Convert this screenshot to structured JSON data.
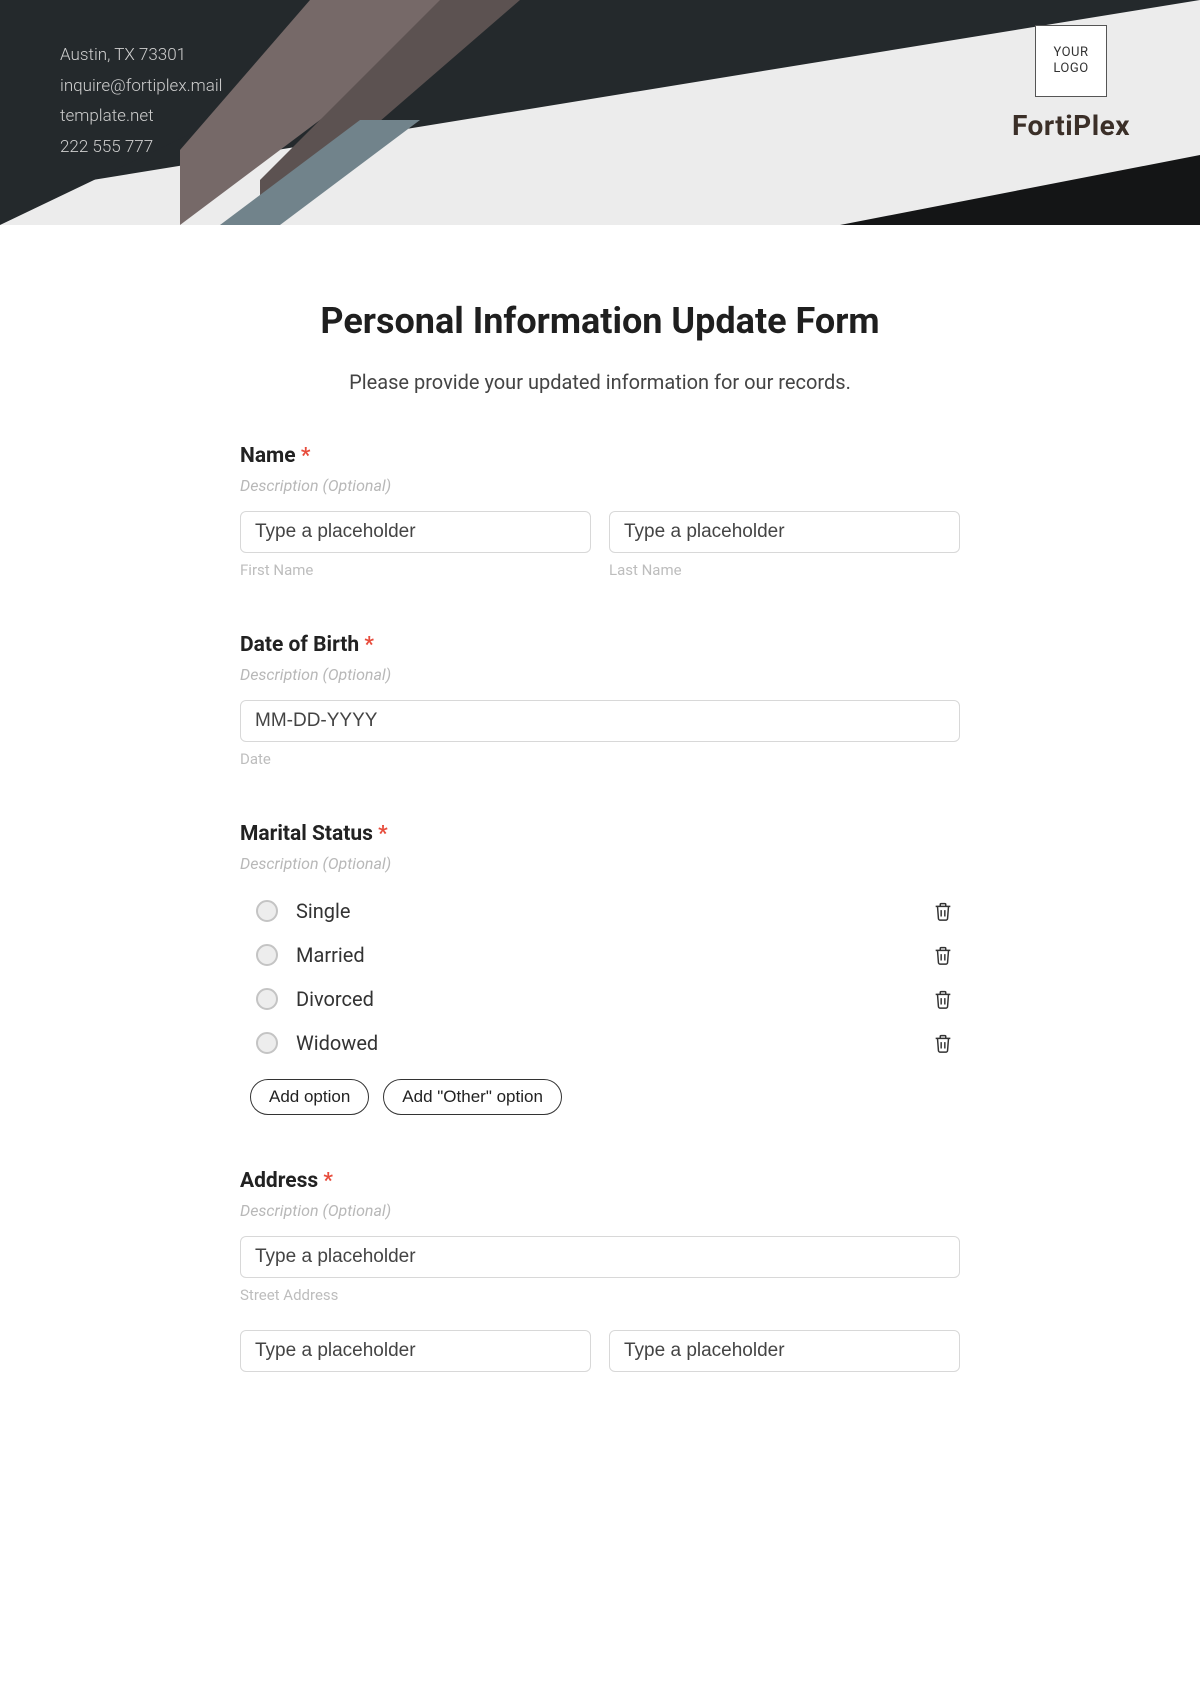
{
  "header": {
    "address": "Austin, TX 73301",
    "email": "inquire@fortiplex.mail",
    "website": "template.net",
    "phone": "222 555 777",
    "logo_line1": "YOUR",
    "logo_line2": "LOGO",
    "company": "FortiPlex"
  },
  "form": {
    "title": "Personal Information Update Form",
    "subtitle": "Please provide your updated information for our records.",
    "name": {
      "label": "Name",
      "required_mark": "*",
      "desc": "Description (Optional)",
      "first_placeholder": "Type a placeholder",
      "last_placeholder": "Type a placeholder",
      "first_sub": "First Name",
      "last_sub": "Last Name"
    },
    "dob": {
      "label": "Date of Birth",
      "required_mark": "*",
      "desc": "Description (Optional)",
      "placeholder": "MM-DD-YYYY",
      "sub": "Date"
    },
    "marital": {
      "label": "Marital Status",
      "required_mark": "*",
      "desc": "Description (Optional)",
      "options": [
        "Single",
        "Married",
        "Divorced",
        "Widowed"
      ],
      "add_option": "Add option",
      "add_other": "Add \"Other\" option"
    },
    "address": {
      "label": "Address",
      "required_mark": "*",
      "desc": "Description (Optional)",
      "street_placeholder": "Type a placeholder",
      "street_sub": "Street Address",
      "city_placeholder": "Type a placeholder",
      "state_placeholder": "Type a placeholder"
    }
  }
}
